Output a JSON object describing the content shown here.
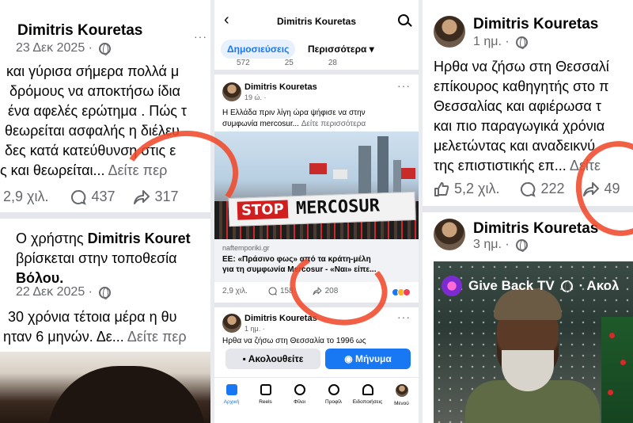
{
  "panel1": {
    "post1": {
      "author": "Dimitris Kouretas",
      "date": "23 Δεκ 2025 ·",
      "lines": [
        "και γύρισα σήμερα πολλά μ",
        "δρόμους να αποκτήσω ίδια",
        "ένα αφελές ερώτημα . Πώς τ",
        "θεωρείται ασφαλής η διέλευ",
        "δες κατά κατεύθυνση στις ε",
        "ς και θεωρείται..."
      ],
      "see_more": "Δείτε περ",
      "likes": "2,9 χιλ.",
      "comments": "437",
      "shares": "317"
    },
    "post2": {
      "line1_prefix": "Ο χρήστης ",
      "line1_name": "Dimitris Kouret",
      "line2": "βρίσκεται στην τοποθεσία ",
      "line3": "Βόλου.",
      "date": "22 Δεκ 2025 ·",
      "text1": "30 χρόνια τέτοια μέρα η θυ",
      "text2": "ηταν 6 μηνών. Δε...",
      "see_more": "Δείτε περ"
    }
  },
  "panel2": {
    "header_title": "Dimitris Kouretas",
    "tab_posts": "Δημοσιεύσεις",
    "tab_more": "Περισσότερα ▾",
    "mini_counts": [
      "572",
      "25",
      "28"
    ],
    "post": {
      "author": "Dimitris Kouretas",
      "time": "19 ώ. ·",
      "text1": "Η Ελλάδα πριν λίγη ώρα ψήφισε να στην",
      "text2": "συμφωνία mercosur... ",
      "see_more": "Δείτε περισσότερα",
      "banner_stop": "STOP",
      "banner_word": "MERCOSUR",
      "link_source": "naftemporiki.gr",
      "link_title1": "ΕΕ: «Πράσινο φως» από τα κράτη-μέλη",
      "link_title2": "για τη συμφωνία Mercosur - «Ναι» είπε...",
      "likes": "2,9 χιλ.",
      "comments": "158",
      "shares": "208"
    },
    "post2": {
      "author": "Dimitris Kouretas",
      "time": "1 ημ. ·",
      "text": "Ηρθα να ζήσω στη Θεσσαλία το 1996 ως"
    },
    "follow_btn": "Ακολουθείτε",
    "message_btn": "Μήνυμα",
    "nav": [
      "Αρχική",
      "Reels",
      "Φίλοι",
      "Προφίλ",
      "Ειδοποιήσεις",
      "Μενού"
    ]
  },
  "panel3": {
    "post1": {
      "author": "Dimitris Kouretas",
      "time": "1 ημ. ·",
      "lines": [
        "Ηρθα να ζήσω στη Θεσσαλί",
        "επίκουρος καθηγητής στο π",
        "Θεσσαλίας και αφιέρωσα τ",
        "και πιο παραγωγικά χρόνια",
        "μελετώντας και αναδεικνύ",
        "της επιστιστικής επ..."
      ],
      "see_more": "Δείτε",
      "likes": "5,2 χιλ.",
      "comments": "222",
      "shares": "49"
    },
    "post2": {
      "author": "Dimitris Kouretas",
      "time": "3 ημ. ·",
      "video_channel": "Give Back TV",
      "video_follow": "· Ακολ"
    }
  },
  "colors": {
    "accent": "#1877f2",
    "circle": "#f04a2c",
    "muted": "#65676b"
  }
}
